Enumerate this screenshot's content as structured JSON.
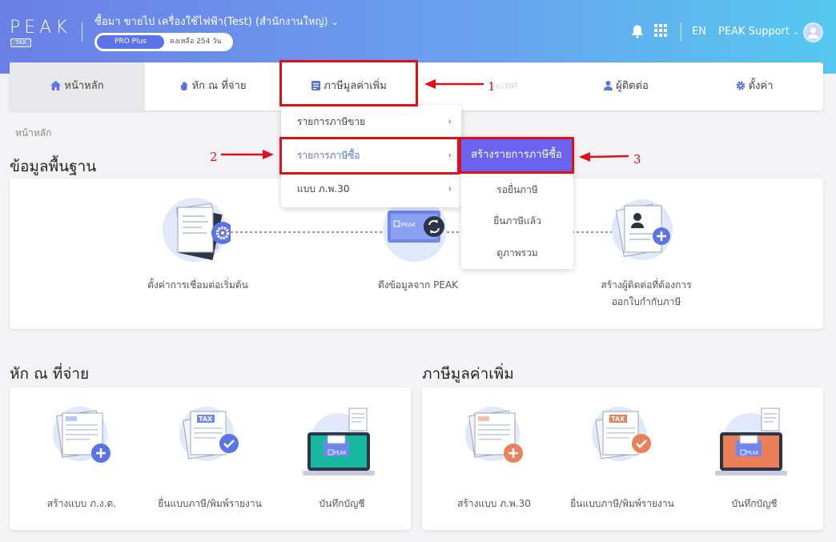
{
  "header": {
    "logo_text": "PEAK",
    "logo_tag": "TAX",
    "company_name": "ซื้อมา ขายไป เครื่องใช้ไฟฟ้า(Test) (สำนักงานใหญ่)",
    "plan": "PRO Plus",
    "plan_remaining": "คงเหลือ 254 วัน",
    "lang": "EN",
    "user_name": "PEAK Support"
  },
  "nav": {
    "items": [
      {
        "label": "หน้าหลัก",
        "icon": "home-icon"
      },
      {
        "label": "หัก ณ ที่จ่าย",
        "icon": "hand-icon"
      },
      {
        "label": "ภาษีมูลค่าเพิ่ม",
        "icon": "document-icon"
      },
      {
        "label": "ระเทศ",
        "icon": ""
      },
      {
        "label": "ผู้ติดต่อ",
        "icon": "user-icon"
      },
      {
        "label": "ตั้งค่า",
        "icon": "gear-icon"
      }
    ]
  },
  "dropdown": {
    "items": [
      {
        "label": "รายการภาษีขาย"
      },
      {
        "label": "รายการภาษีซื้อ"
      },
      {
        "label": "แบบ ภ.พ.30"
      }
    ]
  },
  "submenu": {
    "primary": "สร้างรายการภาษีซื้อ",
    "items": [
      "รอยื่นภาษี",
      "ยื่นภาษีแล้ว",
      "ดูภาพรวม"
    ]
  },
  "annotations": [
    "1",
    "2",
    "3"
  ],
  "breadcrumb": "หน้าหลัก",
  "basic_section": {
    "title": "ข้อมูลพื้นฐาน",
    "steps": [
      {
        "caption": "ตั้งค่าการเชื่อมต่อเริ่มต้น"
      },
      {
        "caption": "ดึงข้อมูลจาก PEAK"
      },
      {
        "caption_line1": "สร้างผู้ติดต่อที่ต้องการ",
        "caption_line2": "ออกใบกำกับภาษี"
      }
    ]
  },
  "wht_section": {
    "title": "หัก ณ ที่จ่าย",
    "items": [
      {
        "caption": "สร้างแบบ ภ.ง.ด."
      },
      {
        "caption": "ยื่นแบบภาษี/พิมพ์รายงาน"
      },
      {
        "caption": "บันทึกบัญชี"
      }
    ]
  },
  "vat_section": {
    "title": "ภาษีมูลค่าเพิ่ม",
    "items": [
      {
        "caption": "สร้างแบบ ภ.พ.30"
      },
      {
        "caption": "ยื่นแบบภาษี/พิมพ์รายงาน"
      },
      {
        "caption": "บันทึกบัญชี"
      }
    ]
  },
  "illustration_labels": {
    "tax": "TAX",
    "peak": "PEAK"
  },
  "colors": {
    "accent": "#6b62f0",
    "annotation": "#e0101a",
    "plus_blue": "#5a73e6",
    "plus_orange": "#e9805a"
  }
}
